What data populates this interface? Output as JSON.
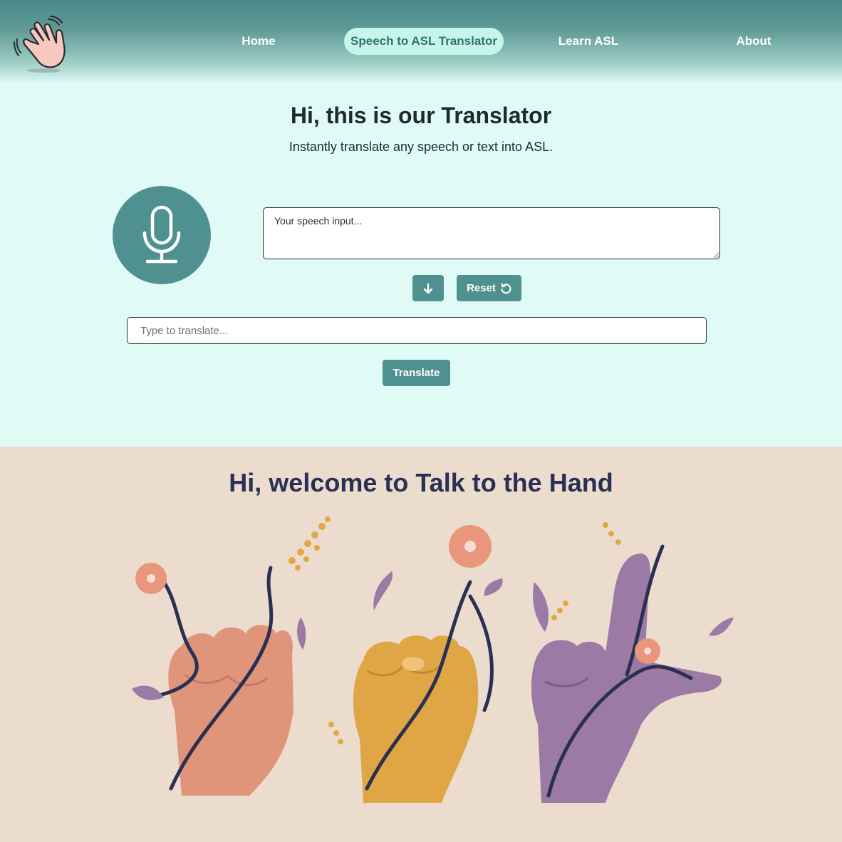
{
  "nav": {
    "items": [
      {
        "label": "Home"
      },
      {
        "label": "Speech to ASL Translator",
        "active": true
      },
      {
        "label": "Learn ASL"
      },
      {
        "label": "About"
      }
    ]
  },
  "translator": {
    "title": "Hi, this is our Translator",
    "subtitle": "Instantly translate any speech or text into ASL.",
    "speech_placeholder": "Your speech input...",
    "reset_label": "Reset",
    "type_placeholder": "Type to translate...",
    "translate_label": "Translate"
  },
  "welcome": {
    "title": "Hi, welcome to Talk to the Hand"
  },
  "icons": {
    "logo": "waving-hand-icon",
    "mic": "microphone-icon",
    "down": "arrow-down-icon",
    "reset": "reset-rotate-icon"
  },
  "colors": {
    "accent": "#4f9190",
    "nav_active_bg": "#c7f5ea",
    "page_bg": "#e0fbf5",
    "welcome_bg": "#ebdccd",
    "welcome_title": "#2b3052",
    "hand_peach": "#e0957b",
    "hand_gold": "#e0a645",
    "hand_purple": "#9b7aa5"
  }
}
